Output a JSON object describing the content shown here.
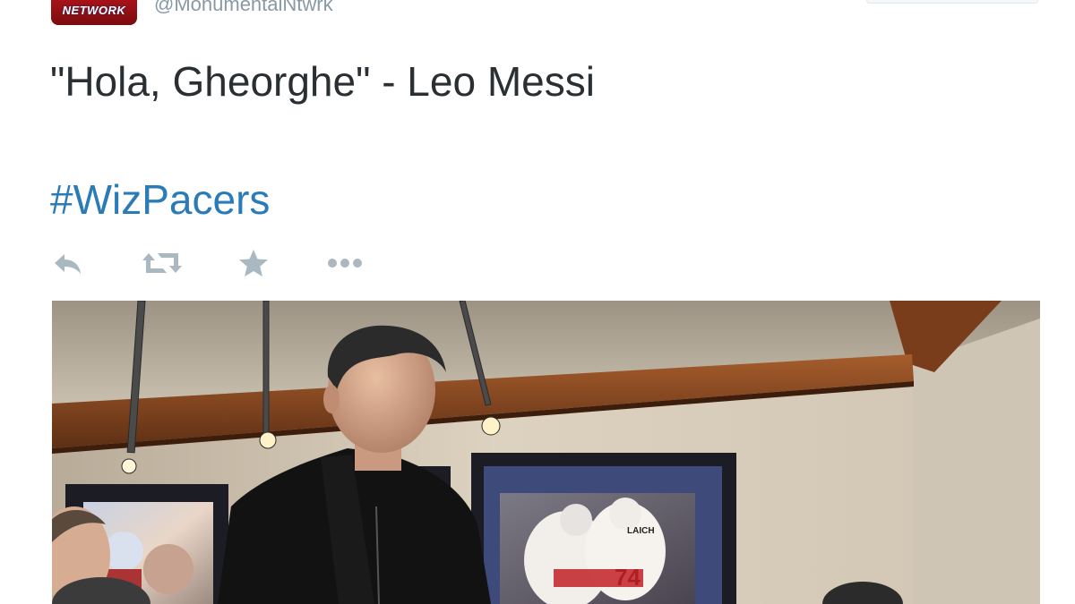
{
  "author": {
    "avatar_text": "NETWORK",
    "handle": "@MonumentalNtwrk"
  },
  "tweet": {
    "text": "\"Hola, Gheorghe\" - Leo Messi",
    "hashtag": "#WizPacers"
  },
  "actions": [
    {
      "icon": "reply-icon"
    },
    {
      "icon": "retweet-icon"
    },
    {
      "icon": "favorite-star-icon"
    },
    {
      "icon": "more-dots-icon"
    }
  ],
  "photo": {
    "jersey_number": "74",
    "jersey_name": "LAICH",
    "colors": {
      "wall": "#d7cbb9",
      "molding": "#8a4a22",
      "sweater": "#111111",
      "frame": "#1c1c24",
      "link": "#2b7bb9",
      "icon": "#aab8c2"
    }
  }
}
